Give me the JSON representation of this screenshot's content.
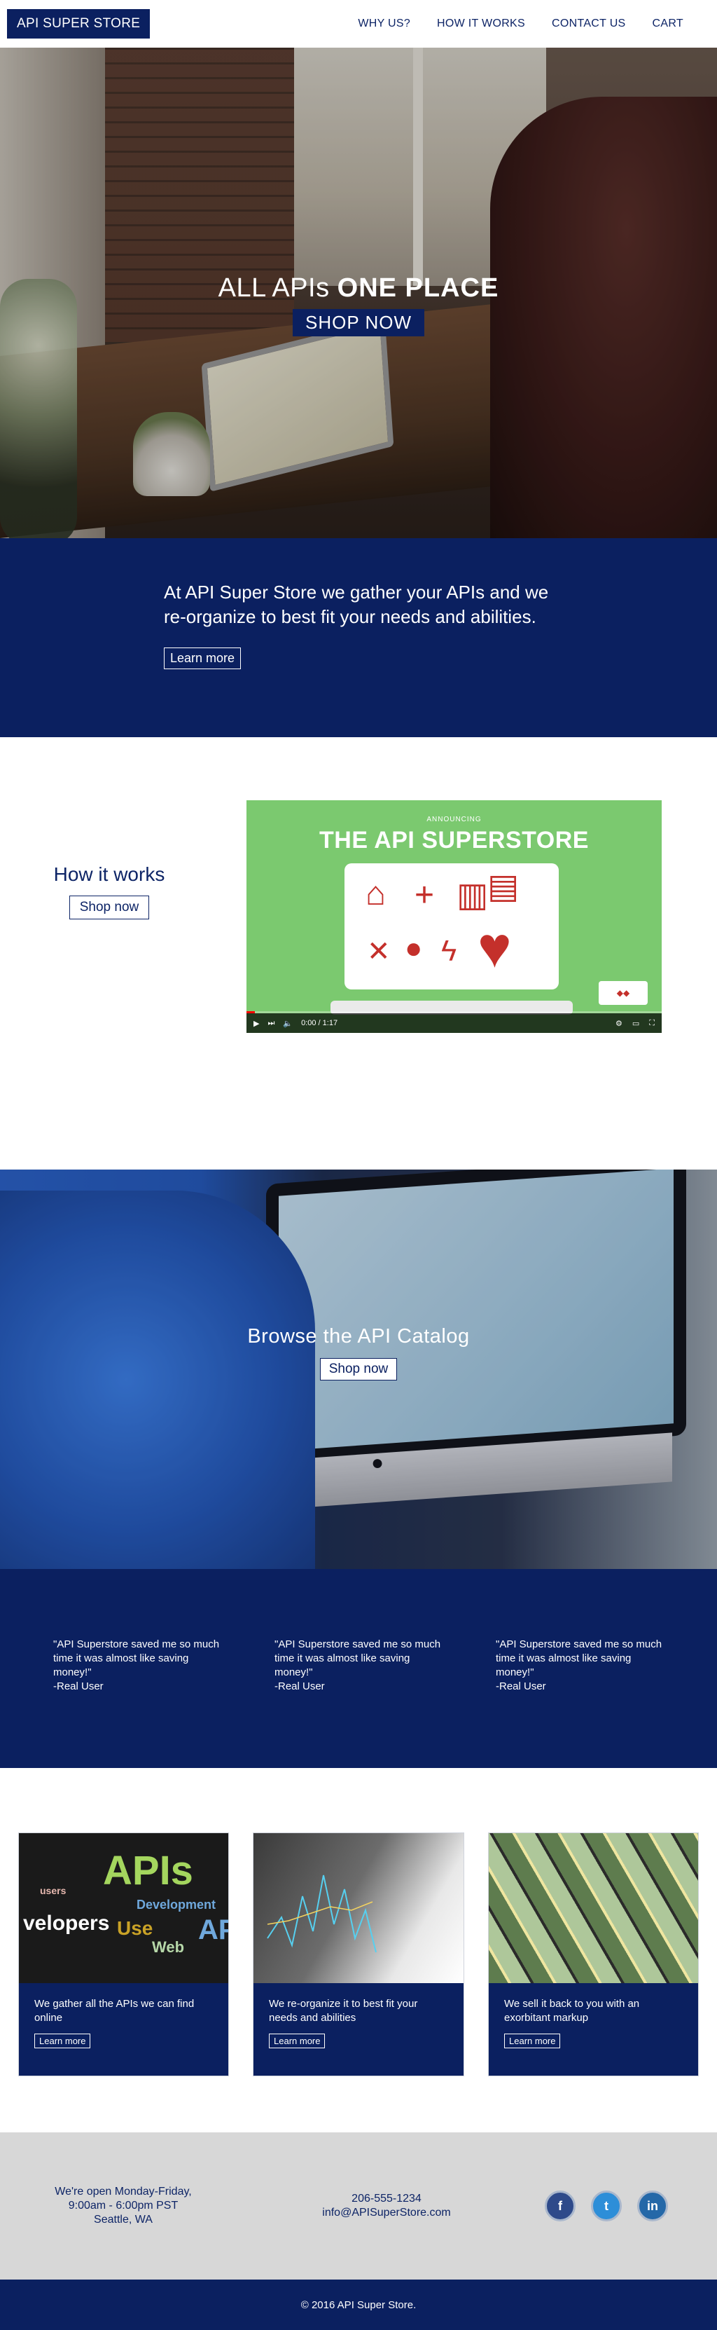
{
  "header": {
    "logo": "API SUPER STORE",
    "nav": [
      "WHY US?",
      "HOW IT WORKS",
      "CONTACT US",
      "CART"
    ]
  },
  "hero": {
    "title_light": "ALL APIs",
    "title_bold": "ONE PLACE",
    "button": "SHOP NOW"
  },
  "intro": {
    "text": "At API Super Store we gather your APIs and we re-organize to best fit your needs and abilities.",
    "button": "Learn more"
  },
  "how": {
    "title": "How it works",
    "button": "Shop now",
    "video": {
      "announcing": "ANNOUNCING",
      "title": "THE API SUPERSTORE",
      "time": "0:00 / 1:17",
      "progress": 0.02
    }
  },
  "catalog": {
    "title": "Browse the API Catalog",
    "button": "Shop now"
  },
  "testimonials": [
    {
      "quote": "\"API Superstore saved me so much time it was almost like saving money!\"",
      "author": "-Real User"
    },
    {
      "quote": "\"API Superstore saved me so much time it was almost like saving money!\"",
      "author": "-Real User"
    },
    {
      "quote": "\"API Superstore saved me so much time it was almost like saving money!\"",
      "author": "-Real User"
    }
  ],
  "cards": [
    {
      "text": "We gather all the APIs we can find online",
      "button": "Learn more"
    },
    {
      "text": "We re-organize it to best fit your needs and abilities",
      "button": "Learn more"
    },
    {
      "text": "We sell it back to you with an exorbitant markup",
      "button": "Learn more"
    }
  ],
  "footer": {
    "hours_line1": "We're open Monday-Friday,",
    "hours_line2": "9:00am - 6:00pm PST",
    "hours_line3": "Seattle, WA",
    "phone": "206-555-1234",
    "email": "info@APISuperStore.com"
  },
  "copyright": "© 2016 API Super Store.",
  "colors": {
    "navy": "#0b2060",
    "footer_gray": "#d7d7d7"
  }
}
